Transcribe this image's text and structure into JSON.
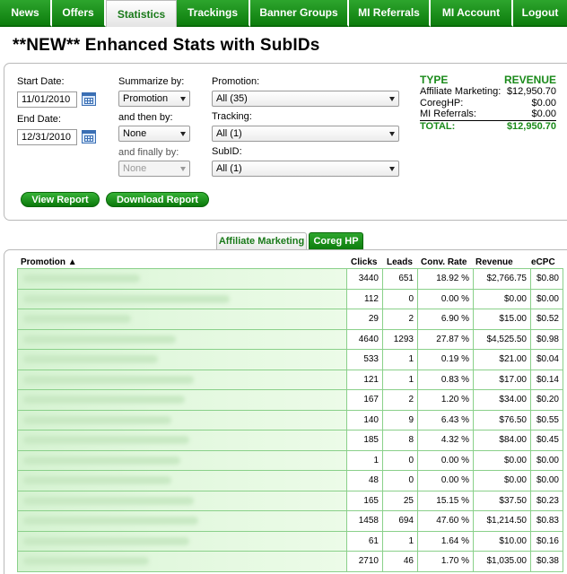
{
  "nav": {
    "items": [
      {
        "label": "News"
      },
      {
        "label": "Offers"
      },
      {
        "label": "Statistics"
      },
      {
        "label": "Trackings"
      },
      {
        "label": "Banner Groups"
      },
      {
        "label": "MI Referrals"
      },
      {
        "label": "MI Account"
      },
      {
        "label": "Logout"
      }
    ],
    "active": "Statistics"
  },
  "page_title": "**NEW** Enhanced Stats with SubIDs",
  "filters": {
    "start_date_label": "Start Date:",
    "start_date": "11/01/2010",
    "end_date_label": "End Date:",
    "end_date": "12/31/2010",
    "summarize_label": "Summarize by:",
    "summarize_value": "Promotion",
    "then_label": "and then by:",
    "then_value": "None",
    "finally_label": "and finally by:",
    "finally_value": "None",
    "promotion_label": "Promotion:",
    "promotion_value": "All (35)",
    "tracking_label": "Tracking:",
    "tracking_value": "All (1)",
    "subid_label": "SubID:",
    "subid_value": "All (1)",
    "view_report": "View Report",
    "download_report": "Download Report"
  },
  "revenue_summary": {
    "type_header": "TYPE",
    "revenue_header": "REVENUE",
    "rows": [
      {
        "type": "Affiliate Marketing:",
        "revenue": "$12,950.70"
      },
      {
        "type": "CoregHP:",
        "revenue": "$0.00"
      },
      {
        "type": "MI Referrals:",
        "revenue": "$0.00"
      }
    ],
    "total_label": "TOTAL:",
    "total_value": "$12,950.70"
  },
  "tabs": [
    {
      "label": "Affiliate Marketing"
    },
    {
      "label": "Coreg HP"
    }
  ],
  "table": {
    "headers": {
      "promotion": "Promotion ▲",
      "clicks": "Clicks",
      "leads": "Leads",
      "conv": "Conv. Rate",
      "revenue": "Revenue",
      "ecpc": "eCPC"
    },
    "rows": [
      {
        "clicks": "3440",
        "leads": "651",
        "conv": "18.92 %",
        "revenue": "$2,766.75",
        "ecpc": "$0.80"
      },
      {
        "clicks": "112",
        "leads": "0",
        "conv": "0.00 %",
        "revenue": "$0.00",
        "ecpc": "$0.00"
      },
      {
        "clicks": "29",
        "leads": "2",
        "conv": "6.90 %",
        "revenue": "$15.00",
        "ecpc": "$0.52"
      },
      {
        "clicks": "4640",
        "leads": "1293",
        "conv": "27.87 %",
        "revenue": "$4,525.50",
        "ecpc": "$0.98"
      },
      {
        "clicks": "533",
        "leads": "1",
        "conv": "0.19 %",
        "revenue": "$21.00",
        "ecpc": "$0.04"
      },
      {
        "clicks": "121",
        "leads": "1",
        "conv": "0.83 %",
        "revenue": "$17.00",
        "ecpc": "$0.14"
      },
      {
        "clicks": "167",
        "leads": "2",
        "conv": "1.20 %",
        "revenue": "$34.00",
        "ecpc": "$0.20"
      },
      {
        "clicks": "140",
        "leads": "9",
        "conv": "6.43 %",
        "revenue": "$76.50",
        "ecpc": "$0.55"
      },
      {
        "clicks": "185",
        "leads": "8",
        "conv": "4.32 %",
        "revenue": "$84.00",
        "ecpc": "$0.45"
      },
      {
        "clicks": "1",
        "leads": "0",
        "conv": "0.00 %",
        "revenue": "$0.00",
        "ecpc": "$0.00"
      },
      {
        "clicks": "48",
        "leads": "0",
        "conv": "0.00 %",
        "revenue": "$0.00",
        "ecpc": "$0.00"
      },
      {
        "clicks": "165",
        "leads": "25",
        "conv": "15.15 %",
        "revenue": "$37.50",
        "ecpc": "$0.23"
      },
      {
        "clicks": "1458",
        "leads": "694",
        "conv": "47.60 %",
        "revenue": "$1,214.50",
        "ecpc": "$0.83"
      },
      {
        "clicks": "61",
        "leads": "1",
        "conv": "1.64 %",
        "revenue": "$10.00",
        "ecpc": "$0.16"
      },
      {
        "clicks": "2710",
        "leads": "46",
        "conv": "1.70 %",
        "revenue": "$1,035.00",
        "ecpc": "$0.38"
      }
    ]
  }
}
